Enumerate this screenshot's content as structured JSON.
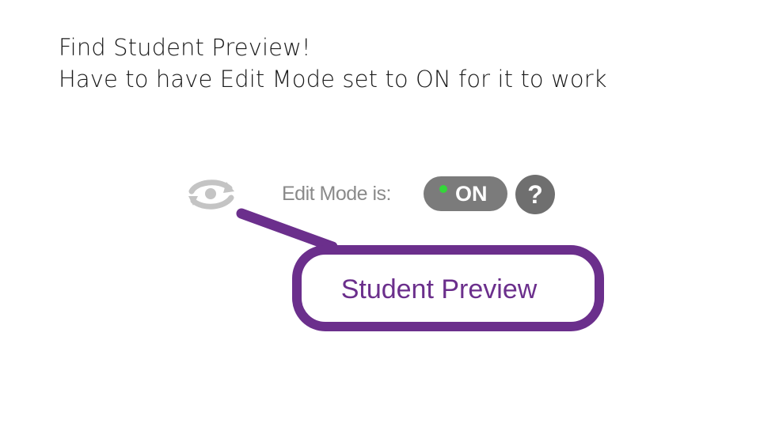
{
  "heading": {
    "line1": "Find Student Preview!",
    "line2": "Have to have Edit Mode set to ON for it to work"
  },
  "toolbar": {
    "preview_icon": "student-preview-eye-icon",
    "edit_mode_label": "Edit Mode is:",
    "toggle_state": "ON",
    "toggle_indicator_color": "#34d63a",
    "help_label": "?"
  },
  "callout": {
    "label": "Student Preview",
    "color": "#6b2f8c"
  }
}
